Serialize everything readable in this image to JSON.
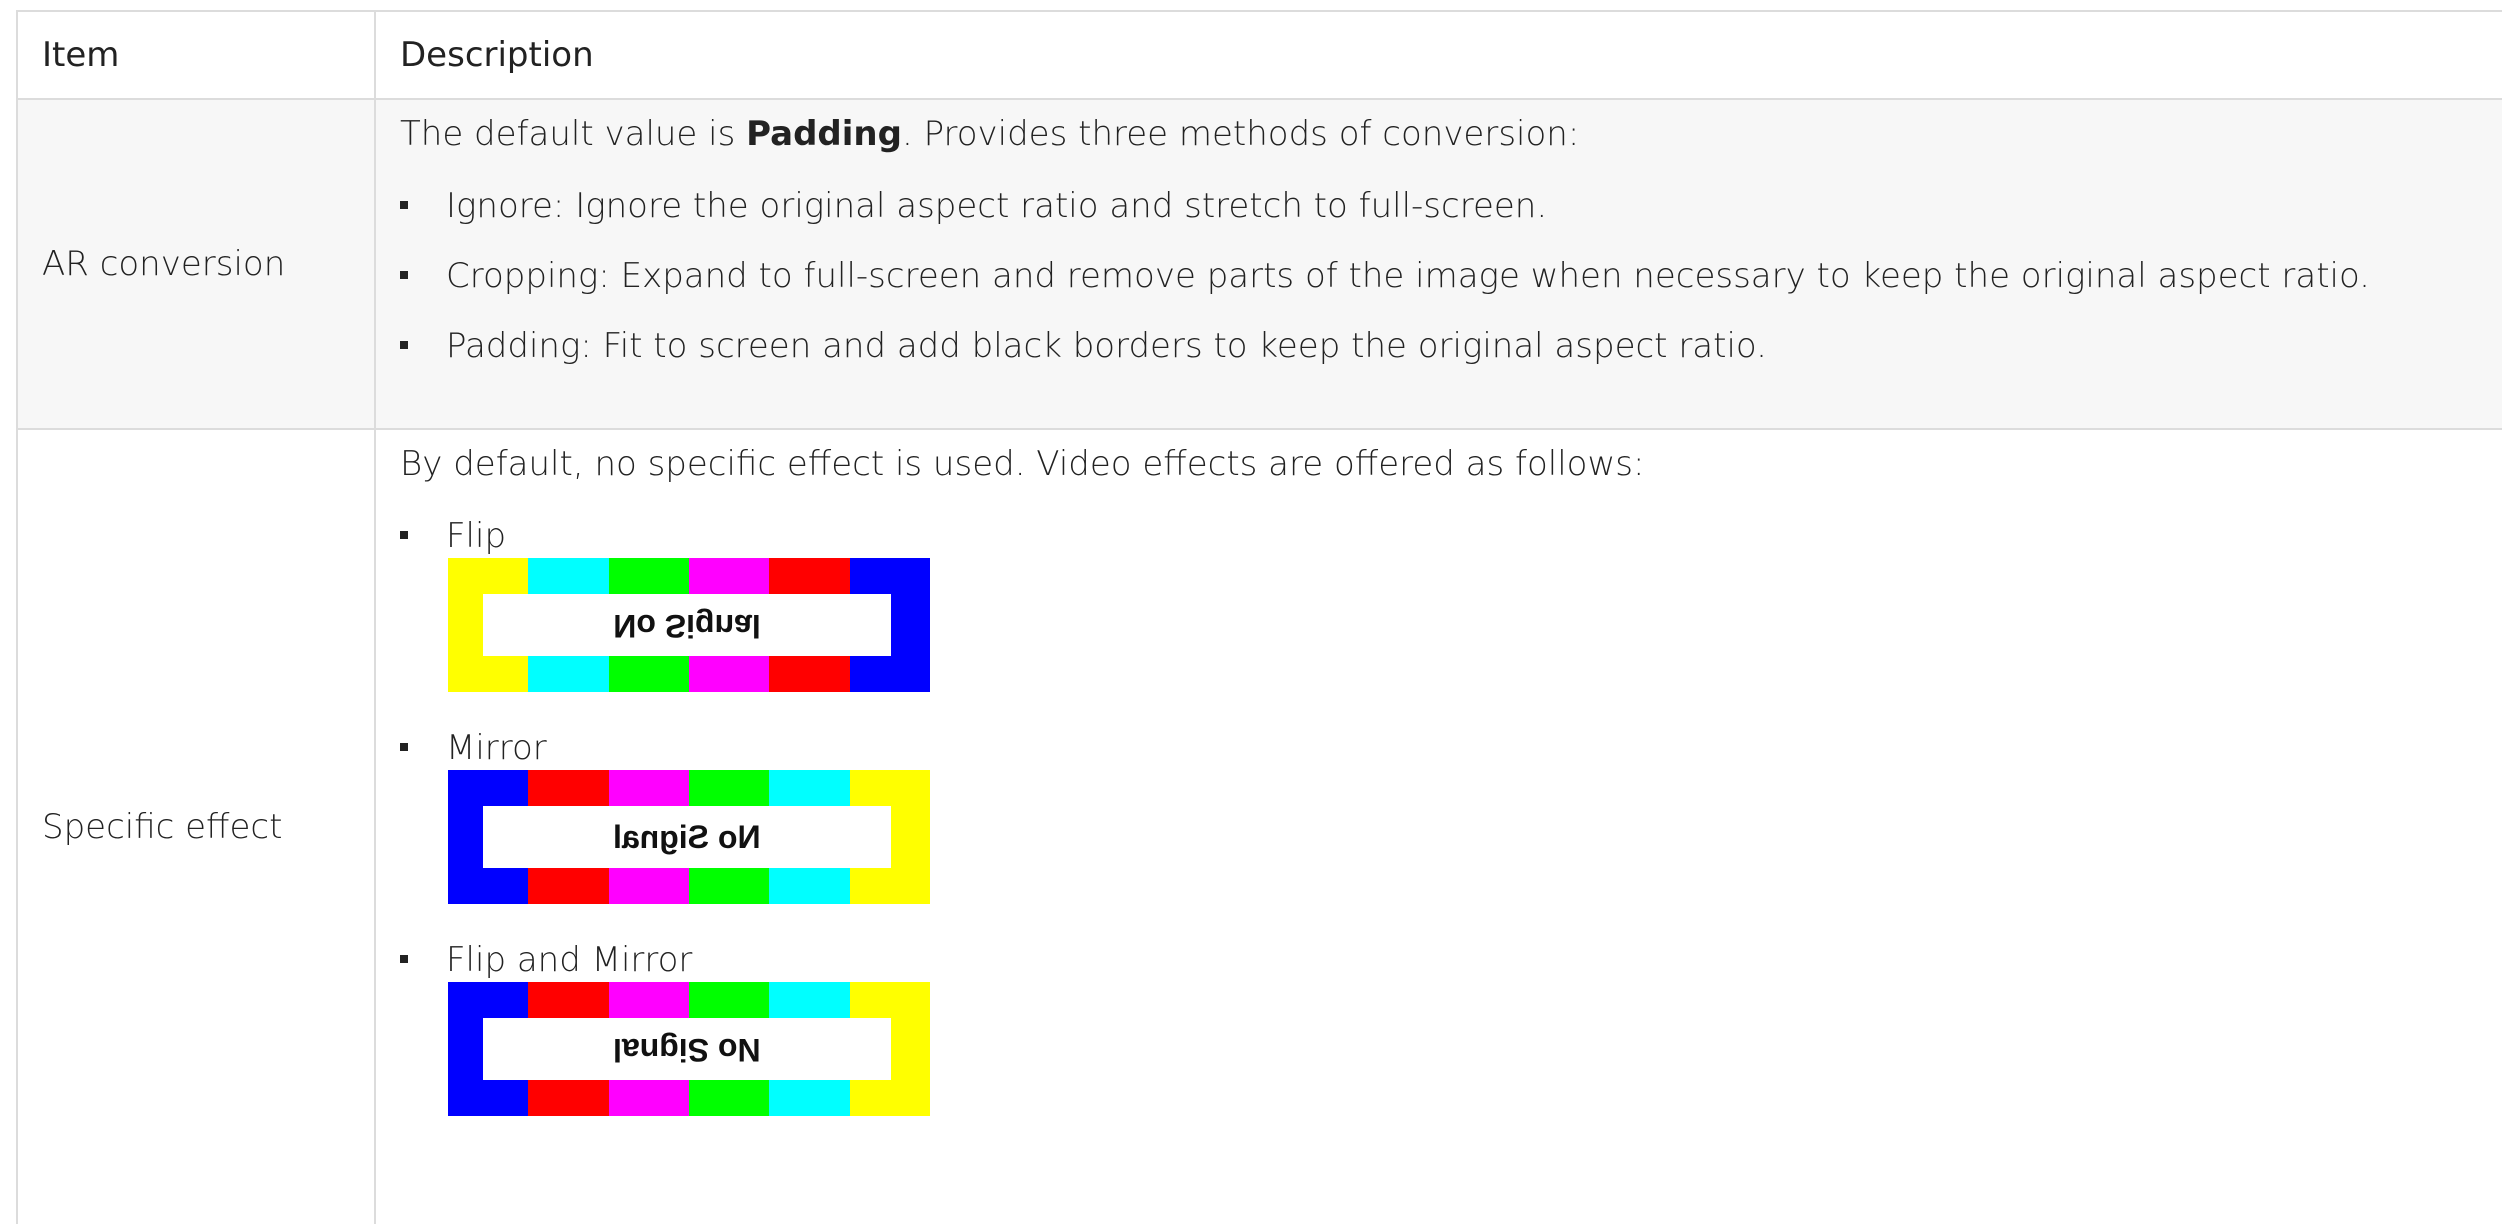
{
  "table": {
    "header": {
      "item": "Item",
      "description": "Description"
    },
    "ar_conversion": {
      "item": "AR conversion",
      "intro_prefix": "The default value is ",
      "intro_bold": "Padding",
      "intro_suffix": ". Provides three methods of conversion:",
      "bullets": [
        "Ignore: Ignore the original aspect ratio and stretch to full-screen.",
        "Cropping: Expand to full-screen and remove parts of the image when necessary to keep the original aspect ratio.",
        "Padding: Fit to screen and add black borders to keep the original aspect ratio."
      ]
    },
    "specific_effect": {
      "item": "Specific effect",
      "intro": "By default, no specific effect is used. Video effects are offered as follows:",
      "effects": [
        {
          "label": "Flip",
          "signal_text": "No Signal"
        },
        {
          "label": "Mirror",
          "signal_text": "No Signal"
        },
        {
          "label": "Flip and Mirror",
          "signal_text": "No Signal"
        }
      ]
    }
  },
  "colors": {
    "yellow": "#ffff00",
    "cyan": "#00ffff",
    "green": "#00ff00",
    "magenta": "#ff00ff",
    "red": "#ff0000",
    "blue": "#0000ff"
  }
}
